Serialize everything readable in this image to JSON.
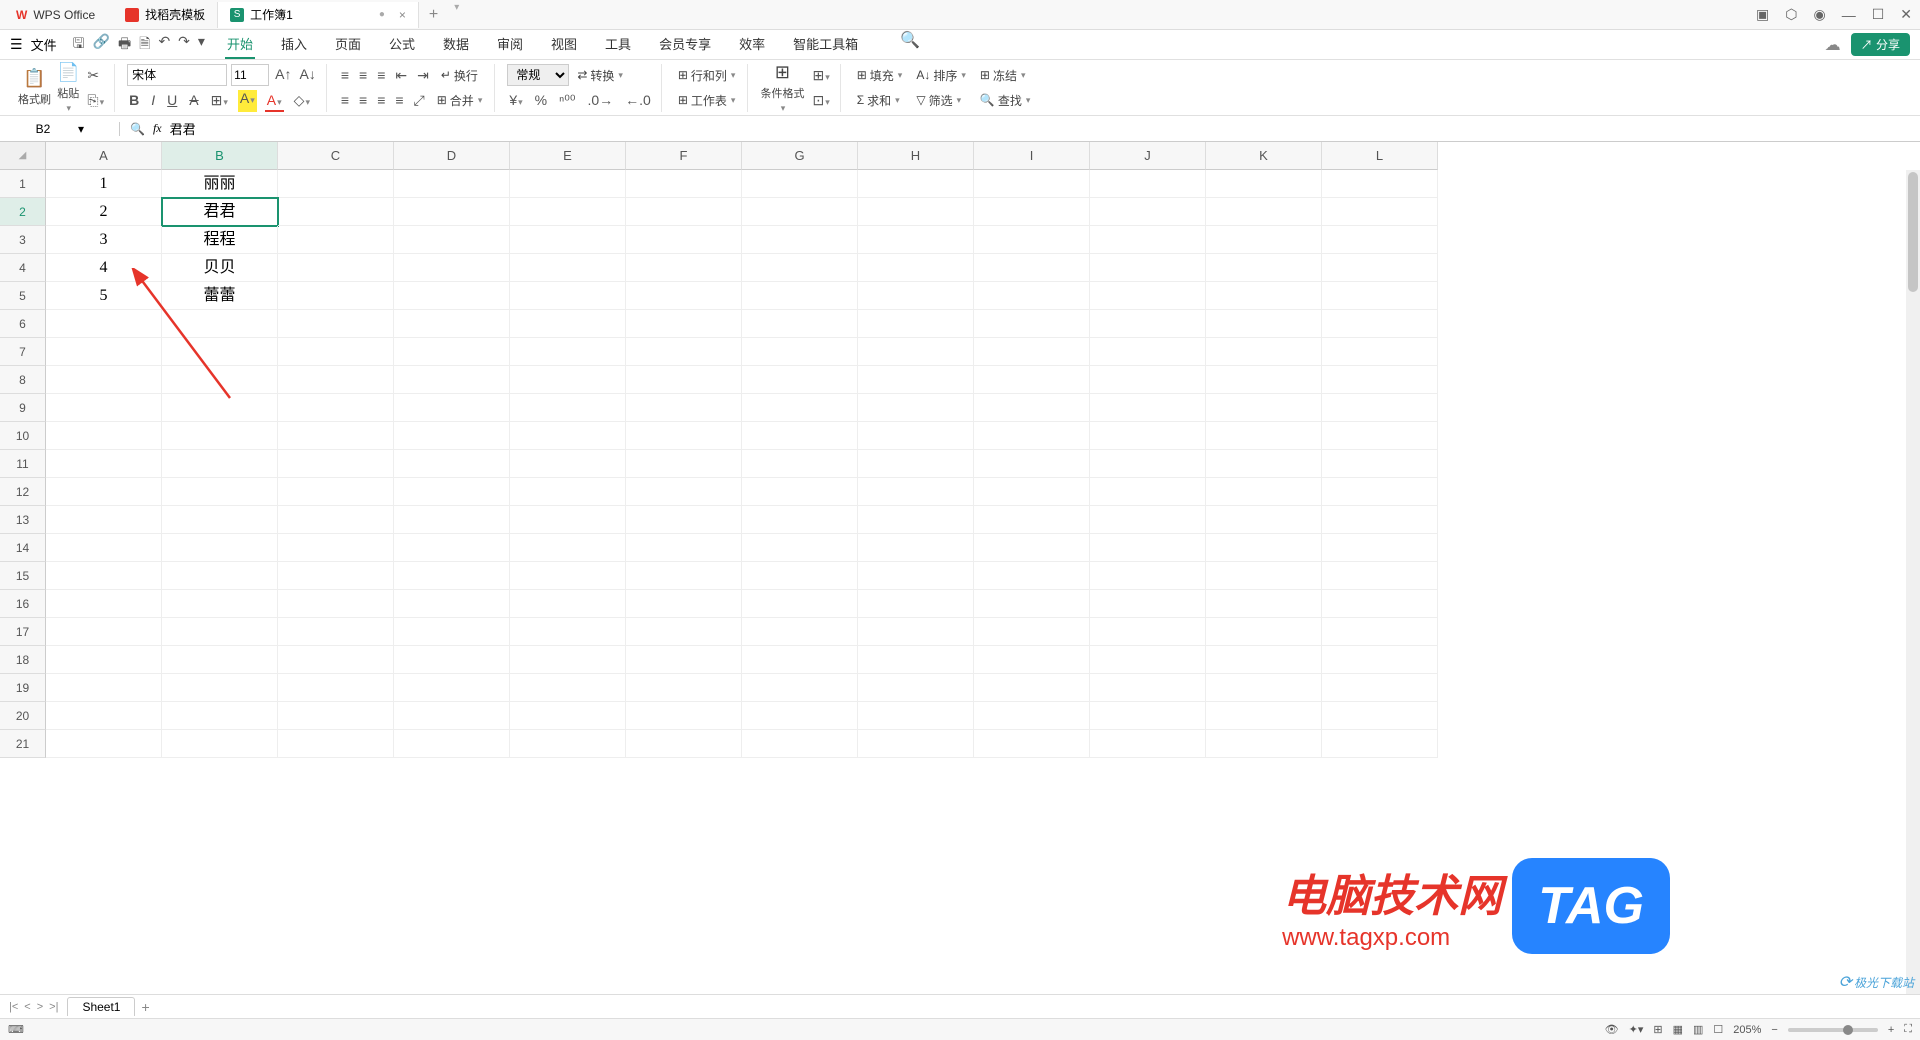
{
  "titlebar": {
    "app_name": "WPS Office",
    "tabs": [
      {
        "label": "找稻壳模板",
        "icon_color": "#e6342a"
      },
      {
        "label": "工作簿1",
        "icon_color": "#1a936f",
        "icon_letter": "S"
      }
    ]
  },
  "menubar": {
    "file_label": "文件",
    "tabs": [
      "开始",
      "插入",
      "页面",
      "公式",
      "数据",
      "审阅",
      "视图",
      "工具",
      "会员专享",
      "效率",
      "智能工具箱"
    ],
    "active_tab": "开始",
    "share_label": "分享"
  },
  "ribbon": {
    "format_painter": "格式刷",
    "paste": "粘贴",
    "font_name": "宋体",
    "font_size": "11",
    "wrap": "换行",
    "number_format": "常规",
    "convert": "转换",
    "rowcol": "行和列",
    "worksheet": "工作表",
    "cond_format": "条件格式",
    "fill": "填充",
    "sort": "排序",
    "freeze": "冻结",
    "sum": "求和",
    "filter": "筛选",
    "find": "查找",
    "merge": "合并"
  },
  "formula_bar": {
    "cell_ref": "B2",
    "formula": "君君"
  },
  "grid": {
    "columns": [
      "A",
      "B",
      "C",
      "D",
      "E",
      "F",
      "G",
      "H",
      "I",
      "J",
      "K",
      "L"
    ],
    "active_col": "B",
    "active_row": 2,
    "row_count": 21,
    "data": {
      "A": [
        "1",
        "2",
        "3",
        "4",
        "5"
      ],
      "B": [
        "丽丽",
        "君君",
        "程程",
        "贝贝",
        "蕾蕾"
      ]
    }
  },
  "sheetbar": {
    "sheet_name": "Sheet1"
  },
  "statusbar": {
    "zoom": "205%"
  },
  "watermark": {
    "line1": "电脑技术网",
    "line2": "www.tagxp.com",
    "tag": "TAG",
    "jiguang": "极光下载站"
  }
}
